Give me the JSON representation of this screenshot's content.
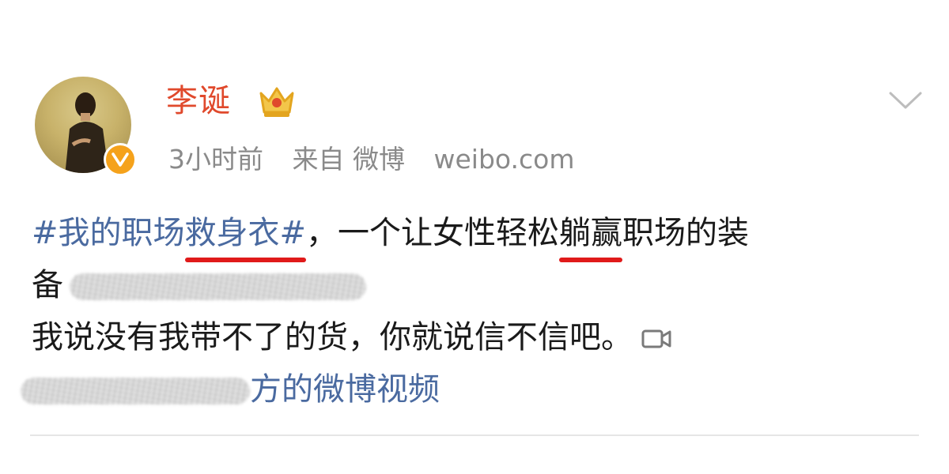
{
  "post": {
    "author": {
      "name": "李诞",
      "avatar_icon": "avatar-photo",
      "verified_icon": "verified-v-badge",
      "member_icon": "crown-icon"
    },
    "meta": {
      "time": "3小时前",
      "source": "来自 微博",
      "domain": "weibo.com"
    },
    "menu_icon": "chevron-down-icon",
    "content": {
      "hashtag": "#我的职场救身衣#",
      "line1_rest_a": "，一个让女性轻松",
      "line1_emph": "躺赢",
      "line1_rest_b": "职场的装",
      "line2_start": "备",
      "line3": "我说没有我带不了的货，你就说信不信吧。",
      "video_icon": "video-camera-icon",
      "video_link_tail": "方的微博视频"
    }
  },
  "colors": {
    "name": "#e0492c",
    "link": "#4a6aa0",
    "underline": "#e01a1a",
    "meta": "#8a8a8a",
    "badge": "#f5a21b"
  }
}
